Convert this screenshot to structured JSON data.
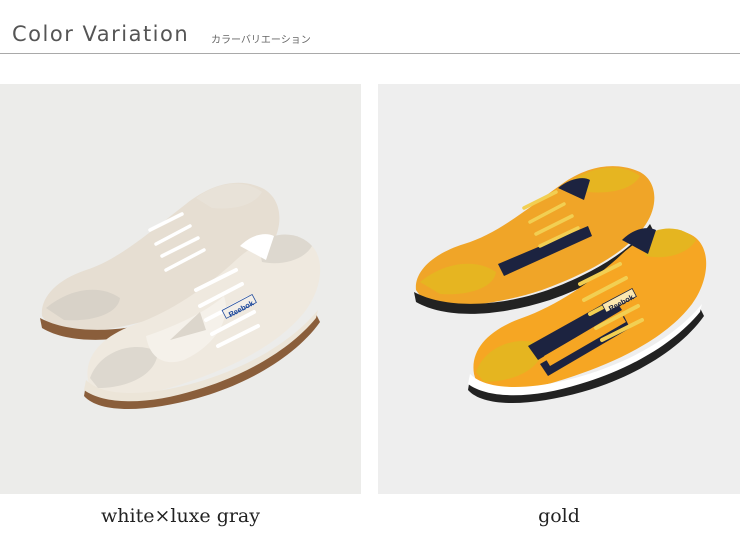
{
  "header": {
    "title": "Color Variation",
    "subtitle": "カラーバリエーション"
  },
  "products": [
    {
      "caption": "white×luxe gray",
      "brand_text": "Reebok",
      "colors": {
        "background": "#ececea",
        "upper": "#efe9df",
        "suede": "#ddd8cf",
        "sole": "#8a5e3b",
        "laces": "#ffffff",
        "accent": "#1f4a9c"
      }
    },
    {
      "caption": "gold",
      "brand_text": "Reebok",
      "colors": {
        "background": "#eeeeee",
        "upper": "#f6a623",
        "suede": "#e5b520",
        "sole": "#222222",
        "laces": "#f2cf52",
        "accent": "#1c2340"
      }
    }
  ]
}
